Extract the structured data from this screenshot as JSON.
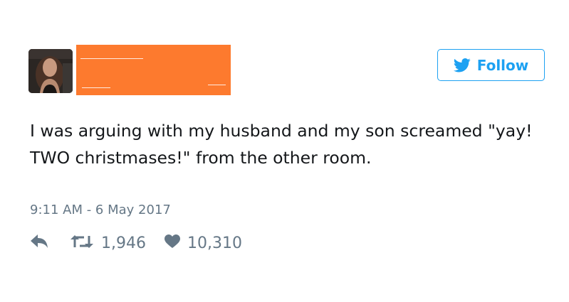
{
  "tweet": {
    "follow_label": "Follow",
    "text": "I was arguing with my husband and my son screamed \"yay! TWO christmases!\" from the other room.",
    "timestamp": "9:11 AM - 6 May 2017",
    "retweet_count": "1,946",
    "like_count": "10,310"
  },
  "icons": {
    "avatar": "user-avatar-photo",
    "redaction": "name-redaction-block",
    "follow": "twitter-bird-icon",
    "reply": "reply-arrow-icon",
    "retweet": "retweet-icon",
    "like": "heart-icon"
  },
  "colors": {
    "accent": "#1da1f2",
    "muted_text": "#657786",
    "text": "#14171a",
    "redaction": "#fd7a2e"
  }
}
